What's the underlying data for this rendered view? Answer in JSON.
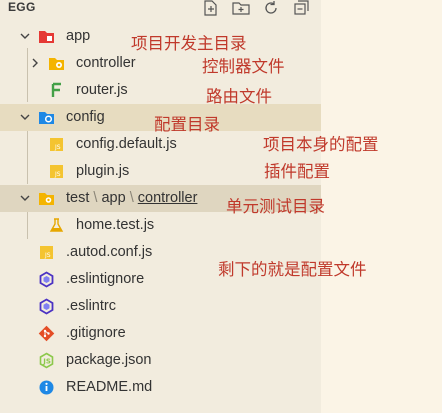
{
  "explorer": {
    "title": "EGG",
    "toolbar": [
      "new-file-icon",
      "new-folder-icon",
      "refresh-icon",
      "collapse-all-icon"
    ]
  },
  "tree": [
    {
      "label": "app",
      "icon": "folder-app-icon",
      "color": "#e53935",
      "expanded": true
    },
    {
      "label": "controller",
      "icon": "folder-controller-icon",
      "color": "#f4b400",
      "expanded": false
    },
    {
      "label": "router.js",
      "icon": "router-file-icon",
      "color": "#43a047"
    },
    {
      "label": "config",
      "icon": "folder-config-icon",
      "color": "#1e88e5",
      "expanded": true
    },
    {
      "label": "config.default.js",
      "icon": "js-file-icon",
      "color": "#f4c430"
    },
    {
      "label": "plugin.js",
      "icon": "js-file-icon",
      "color": "#f4c430"
    },
    {
      "label": "test",
      "sep1": "\\",
      "mid": "app",
      "sep2": "\\",
      "last": "controller",
      "icon": "folder-test-icon",
      "color": "#f4b400",
      "expanded": true
    },
    {
      "label": "home.test.js",
      "icon": "test-file-icon",
      "color": "#e6a700"
    },
    {
      "label": ".autod.conf.js",
      "icon": "js-file-icon",
      "color": "#f4c430"
    },
    {
      "label": ".eslintignore",
      "icon": "eslint-icon",
      "color": "#4b32c3"
    },
    {
      "label": ".eslintrc",
      "icon": "eslint-icon",
      "color": "#4b32c3"
    },
    {
      "label": ".gitignore",
      "icon": "git-icon",
      "color": "#e44d26"
    },
    {
      "label": "package.json",
      "icon": "nodejs-icon",
      "color": "#8cc84b"
    },
    {
      "label": "README.md",
      "icon": "info-icon",
      "color": "#1e88e5"
    }
  ],
  "annotations": {
    "app": "项目开发主目录",
    "controller": "控制器文件",
    "router": "路由文件",
    "config": "配置目录",
    "config_default": "项目本身的配置",
    "plugin": "插件配置",
    "test": "单元测试目录",
    "rest": "剩下的就是配置文件"
  },
  "colors": {
    "explorer_bg": "#f2ecde",
    "pane_bg": "#fbf4e6",
    "annotation": "#c0392b"
  }
}
